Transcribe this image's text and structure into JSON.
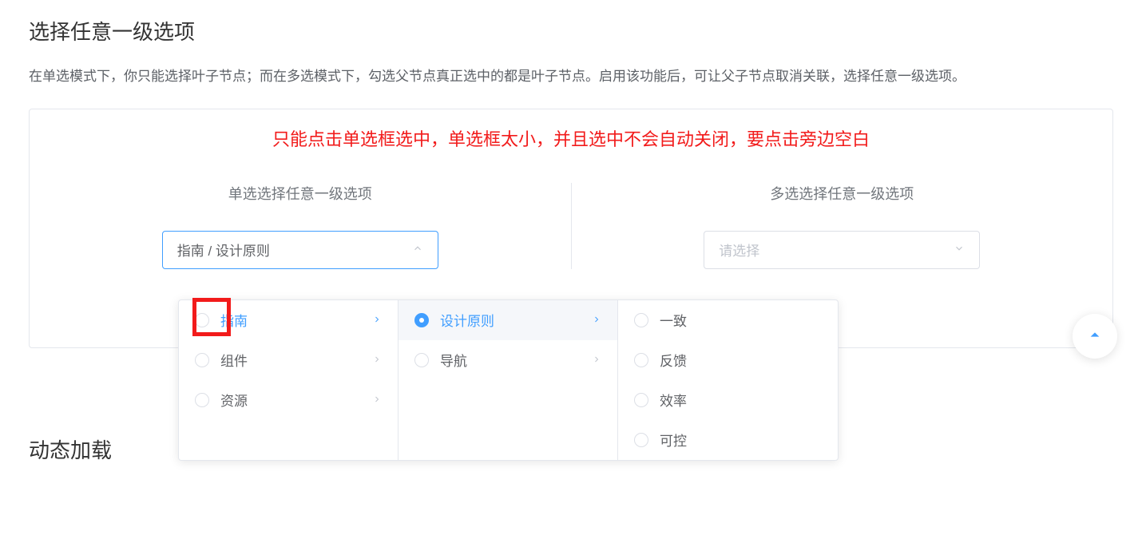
{
  "page": {
    "title": "选择任意一级选项",
    "description": "在单选模式下，你只能选择叶子节点；而在多选模式下，勾选父节点真正选中的都是叶子节点。启用该功能后，可让父子节点取消关联，选择任意一级选项。"
  },
  "annotation": "只能点击单选框选中，单选框太小，并且选中不会自动关闭，要点击旁边空白",
  "single": {
    "label": "单选选择任意一级选项",
    "value": "指南 / 设计原则"
  },
  "multi": {
    "label": "多选选择任意一级选项",
    "placeholder": "请选择"
  },
  "panel": {
    "menu1": [
      {
        "label": "指南",
        "active": true,
        "hasChildren": true
      },
      {
        "label": "组件",
        "active": false,
        "hasChildren": true
      },
      {
        "label": "资源",
        "active": false,
        "hasChildren": true
      }
    ],
    "menu2": [
      {
        "label": "设计原则",
        "active": true,
        "checked": true,
        "hasChildren": true,
        "hovered": true
      },
      {
        "label": "导航",
        "active": false,
        "hasChildren": true
      }
    ],
    "menu3": [
      {
        "label": "一致",
        "active": false,
        "hasChildren": false
      },
      {
        "label": "反馈",
        "active": false,
        "hasChildren": false
      },
      {
        "label": "效率",
        "active": false,
        "hasChildren": false
      },
      {
        "label": "可控",
        "active": false,
        "hasChildren": false
      }
    ]
  },
  "next_section": "动态加载",
  "colors": {
    "primary": "#409eff",
    "danger": "#f21b1b",
    "border": "#dcdfe6",
    "text": "#606266",
    "placeholder": "#c0c4cc"
  }
}
